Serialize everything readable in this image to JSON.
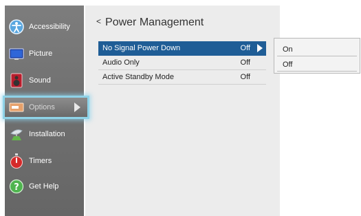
{
  "sidebar": {
    "items": [
      {
        "label": "Accessibility",
        "icon": "accessibility-icon"
      },
      {
        "label": "Picture",
        "icon": "picture-icon"
      },
      {
        "label": "Sound",
        "icon": "speaker-icon"
      },
      {
        "label": "Options",
        "icon": "options-icon",
        "selected": true
      },
      {
        "label": "Installation",
        "icon": "satellite-dish-icon"
      },
      {
        "label": "Timers",
        "icon": "timer-icon"
      },
      {
        "label": "Get Help",
        "icon": "help-icon"
      }
    ]
  },
  "main": {
    "back_glyph": "<",
    "title": "Power Management",
    "rows": [
      {
        "label": "No Signal Power Down",
        "value": "Off",
        "active": true
      },
      {
        "label": "Audio Only",
        "value": "Off"
      },
      {
        "label": "Active Standby Mode",
        "value": "Off"
      }
    ]
  },
  "popup": {
    "options": [
      "On",
      "Off"
    ]
  },
  "colors": {
    "highlight": "#1f5d96",
    "selection_glow": "#8fd3e8",
    "sidebar": "#727272"
  }
}
